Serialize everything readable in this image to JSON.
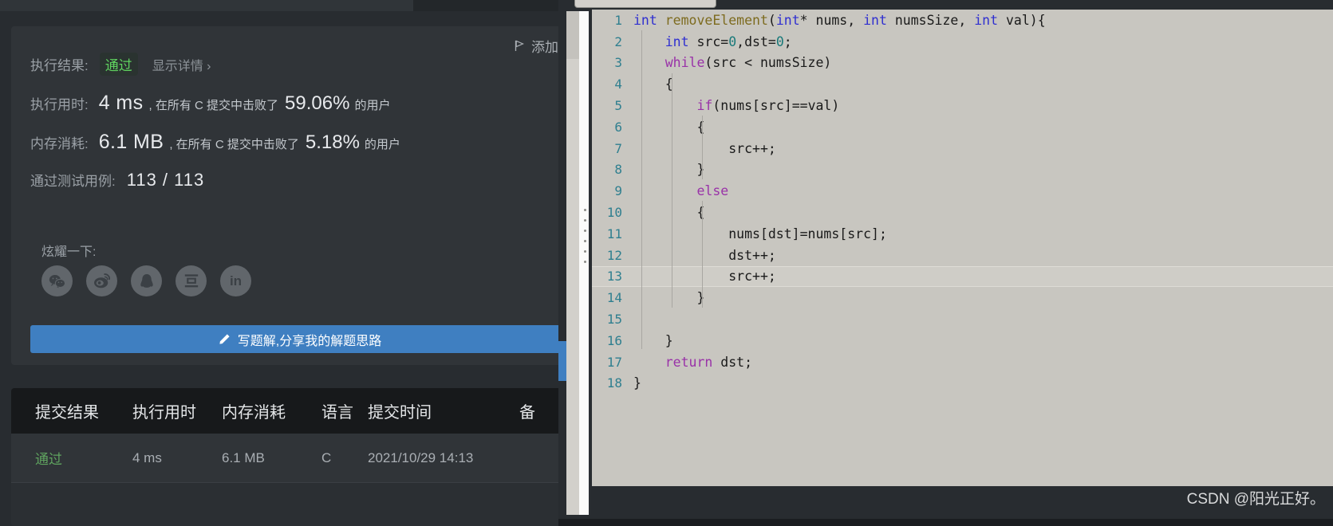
{
  "left": {
    "result_card": {
      "result_label": "执行结果:",
      "result_value": "通过",
      "detail_link": "显示详情 ›",
      "add_note": "添加",
      "runtime_label": "执行用时:",
      "runtime_value": "4 ms",
      "runtime_text_a": ", 在所有 C 提交中击败了",
      "runtime_percent": "59.06%",
      "runtime_text_b": "的用户",
      "memory_label": "内存消耗:",
      "memory_value": "6.1 MB",
      "memory_text_a": ", 在所有 C 提交中击败了",
      "memory_percent": "5.18%",
      "memory_text_b": "的用户",
      "cases_label": "通过测试用例:",
      "cases_value": "113 / 113",
      "share_label": "炫耀一下:",
      "share_icons": [
        {
          "name": "wechat-icon",
          "label": "微信"
        },
        {
          "name": "weibo-icon",
          "label": "微博"
        },
        {
          "name": "qq-icon",
          "label": "QQ"
        },
        {
          "name": "douban-icon",
          "label": "豆瓣"
        },
        {
          "name": "linkedin-icon",
          "label": "in"
        }
      ],
      "write_solution_button": "写题解,分享我的解题思路"
    },
    "submissions": {
      "headers": [
        "提交结果",
        "执行用时",
        "内存消耗",
        "语言",
        "提交时间",
        "备"
      ],
      "rows": [
        {
          "status": "通过",
          "runtime": "4 ms",
          "memory": "6.1 MB",
          "language": "C",
          "time": "2021/10/29 14:13",
          "note": ""
        }
      ]
    }
  },
  "editor": {
    "language": "c",
    "highlight_line": 13,
    "lines": [
      {
        "n": "1",
        "tokens": [
          {
            "t": "int",
            "c": "kw"
          },
          {
            "t": " ",
            "c": ""
          },
          {
            "t": "removeElement",
            "c": "fn"
          },
          {
            "t": "(",
            "c": ""
          },
          {
            "t": "int",
            "c": "kw"
          },
          {
            "t": "* nums, ",
            "c": ""
          },
          {
            "t": "int",
            "c": "kw"
          },
          {
            "t": " numsSize, ",
            "c": ""
          },
          {
            "t": "int",
            "c": "kw"
          },
          {
            "t": " val){",
            "c": ""
          }
        ]
      },
      {
        "n": "2",
        "tokens": [
          {
            "t": "    ",
            "c": ""
          },
          {
            "t": "int",
            "c": "kw"
          },
          {
            "t": " src=",
            "c": ""
          },
          {
            "t": "0",
            "c": "num"
          },
          {
            "t": ",dst=",
            "c": ""
          },
          {
            "t": "0",
            "c": "num"
          },
          {
            "t": ";",
            "c": ""
          }
        ]
      },
      {
        "n": "3",
        "tokens": [
          {
            "t": "    ",
            "c": ""
          },
          {
            "t": "while",
            "c": "kw2"
          },
          {
            "t": "(src < numsSize)",
            "c": ""
          }
        ]
      },
      {
        "n": "4",
        "tokens": [
          {
            "t": "    {",
            "c": ""
          }
        ]
      },
      {
        "n": "5",
        "tokens": [
          {
            "t": "        ",
            "c": ""
          },
          {
            "t": "if",
            "c": "kw2"
          },
          {
            "t": "(nums[src]==val)",
            "c": ""
          }
        ]
      },
      {
        "n": "6",
        "tokens": [
          {
            "t": "        {",
            "c": ""
          }
        ]
      },
      {
        "n": "7",
        "tokens": [
          {
            "t": "            src++;",
            "c": ""
          }
        ]
      },
      {
        "n": "8",
        "tokens": [
          {
            "t": "        }",
            "c": ""
          }
        ]
      },
      {
        "n": "9",
        "tokens": [
          {
            "t": "        ",
            "c": ""
          },
          {
            "t": "else",
            "c": "kw2"
          }
        ]
      },
      {
        "n": "10",
        "tokens": [
          {
            "t": "        {",
            "c": ""
          }
        ]
      },
      {
        "n": "11",
        "tokens": [
          {
            "t": "            nums[dst]=nums[src];",
            "c": ""
          }
        ]
      },
      {
        "n": "12",
        "tokens": [
          {
            "t": "            dst++;",
            "c": ""
          }
        ]
      },
      {
        "n": "13",
        "tokens": [
          {
            "t": "            src++;",
            "c": ""
          }
        ]
      },
      {
        "n": "14",
        "tokens": [
          {
            "t": "        }",
            "c": ""
          }
        ]
      },
      {
        "n": "15",
        "tokens": [
          {
            "t": "",
            "c": ""
          }
        ]
      },
      {
        "n": "16",
        "tokens": [
          {
            "t": "    }",
            "c": ""
          }
        ]
      },
      {
        "n": "17",
        "tokens": [
          {
            "t": "    ",
            "c": ""
          },
          {
            "t": "return",
            "c": "kw2"
          },
          {
            "t": " dst;",
            "c": ""
          }
        ]
      },
      {
        "n": "18",
        "tokens": [
          {
            "t": "}",
            "c": ""
          }
        ]
      }
    ]
  },
  "watermark": "CSDN @阳光正好。",
  "colors": {
    "accent_blue": "#3f7fc1",
    "pass_green": "#5fd25f",
    "panel_bg": "#303438",
    "app_bg": "#282c30",
    "editor_bg": "#c8c6c0",
    "keyword_blue": "#2f2fd0",
    "keyword_purple": "#9932a8",
    "function_olive": "#7d6b1e",
    "linenum_teal": "#2f7f8f"
  }
}
